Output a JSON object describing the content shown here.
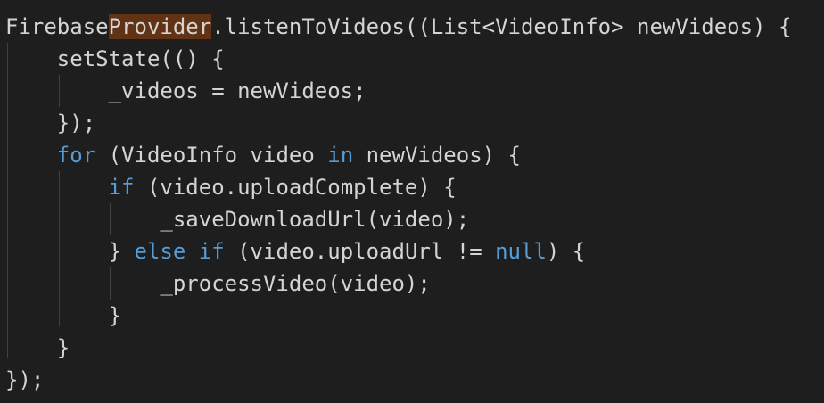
{
  "code": {
    "l1": {
      "a": "Firebase",
      "b": "Provider",
      "c": ".listenToVideos((List<VideoInfo> newVideos) {"
    },
    "l2": {
      "a": "    setState(() {"
    },
    "l3": {
      "a": "        _videos = newVideos;"
    },
    "l4": {
      "a": "    });"
    },
    "l5": {
      "indent": "    ",
      "kw": "for",
      "rest1": " (VideoInfo video ",
      "kw2": "in",
      "rest2": " newVideos) {"
    },
    "l6": {
      "indent": "        ",
      "kw": "if",
      "rest": " (video.uploadComplete) {"
    },
    "l7": {
      "a": "            _saveDownloadUrl(video);"
    },
    "l8": {
      "pre": "        } ",
      "kw1": "else",
      "sp": " ",
      "kw2": "if",
      "mid": " (video.uploadUrl != ",
      "kw3": "null",
      "end": ") {"
    },
    "l9": {
      "a": "            _processVideo(video);"
    },
    "l10": {
      "a": "        }"
    },
    "l11": {
      "a": "    }"
    },
    "l12": {
      "a": "});"
    }
  },
  "colors": {
    "background": "#1e1e1e",
    "text": "#d4d4d4",
    "keyword": "#569cd6",
    "highlight": "#613214",
    "indent_guide": "#404040"
  }
}
